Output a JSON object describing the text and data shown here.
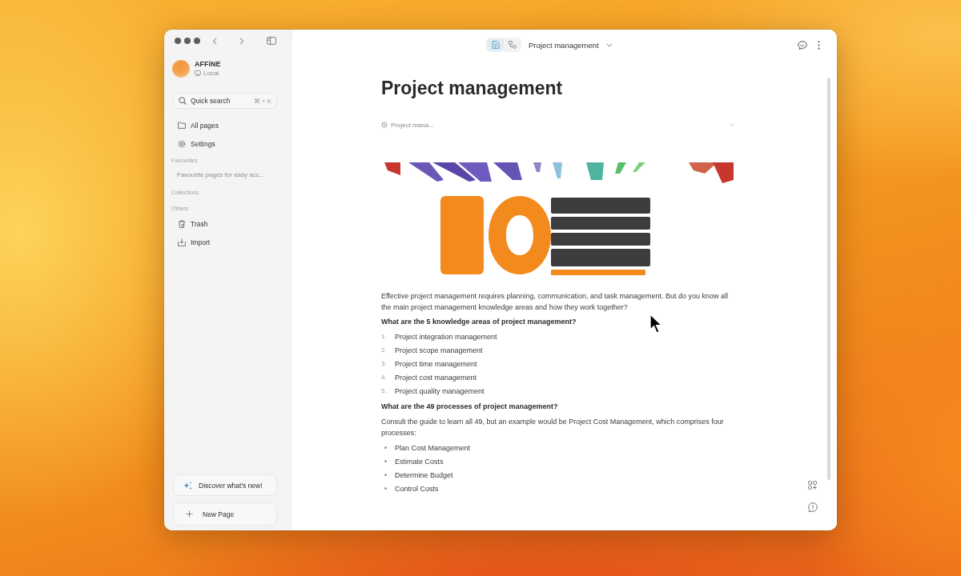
{
  "sidebar": {
    "workspace": {
      "name": "AFFiNE",
      "storage": "Local"
    },
    "search": {
      "label": "Quick search",
      "shortcut": "⌘ + K"
    },
    "nav": [
      {
        "kind": "pages",
        "label": "All pages"
      },
      {
        "kind": "settings",
        "label": "Settings"
      }
    ],
    "sections": [
      {
        "title": "Favourites",
        "hint": "Favourite pages for easy acc..."
      },
      {
        "title": "Collections"
      },
      {
        "title": "Others",
        "items": [
          {
            "kind": "trash",
            "label": "Trash"
          },
          {
            "kind": "import",
            "label": "Import"
          }
        ]
      }
    ],
    "discover": "Discover what's new!",
    "new_page": "New Page"
  },
  "header": {
    "modes": [
      {
        "kind": "page",
        "selected": true
      },
      {
        "kind": "edgeless",
        "selected": false
      }
    ],
    "title": "Project management"
  },
  "document": {
    "title": "Project management",
    "linked_doc": "Project mana...",
    "blocks": [
      {
        "kind": "image"
      },
      {
        "kind": "paragraph",
        "text": "Effective project management requires planning, communication, and task management. But do you know all the main project management knowledge areas and how they work together?"
      },
      {
        "kind": "heading",
        "text": "What are the 5 knowledge areas of project management?"
      },
      {
        "kind": "numbered",
        "items": [
          {
            "number": "1.",
            "text": "Project integration management"
          },
          {
            "number": "2.",
            "text": "Project scope management"
          },
          {
            "number": "3.",
            "text": "Project time management"
          },
          {
            "number": "4.",
            "text": "Project cost management"
          },
          {
            "number": "5.",
            "text": "Project quality management"
          }
        ]
      },
      {
        "kind": "heading",
        "text": "What are the 49 processes of project management?"
      },
      {
        "kind": "paragraph",
        "text": "Consult the guide to learn all 49, but an example would be Project Cost Management, which comprises four processes:"
      },
      {
        "kind": "bulleted",
        "items": [
          {
            "text": "Plan Cost Management"
          },
          {
            "text": "Estimate Costs"
          },
          {
            "text": "Determine Budget"
          },
          {
            "text": "Control Costs"
          }
        ]
      }
    ]
  }
}
